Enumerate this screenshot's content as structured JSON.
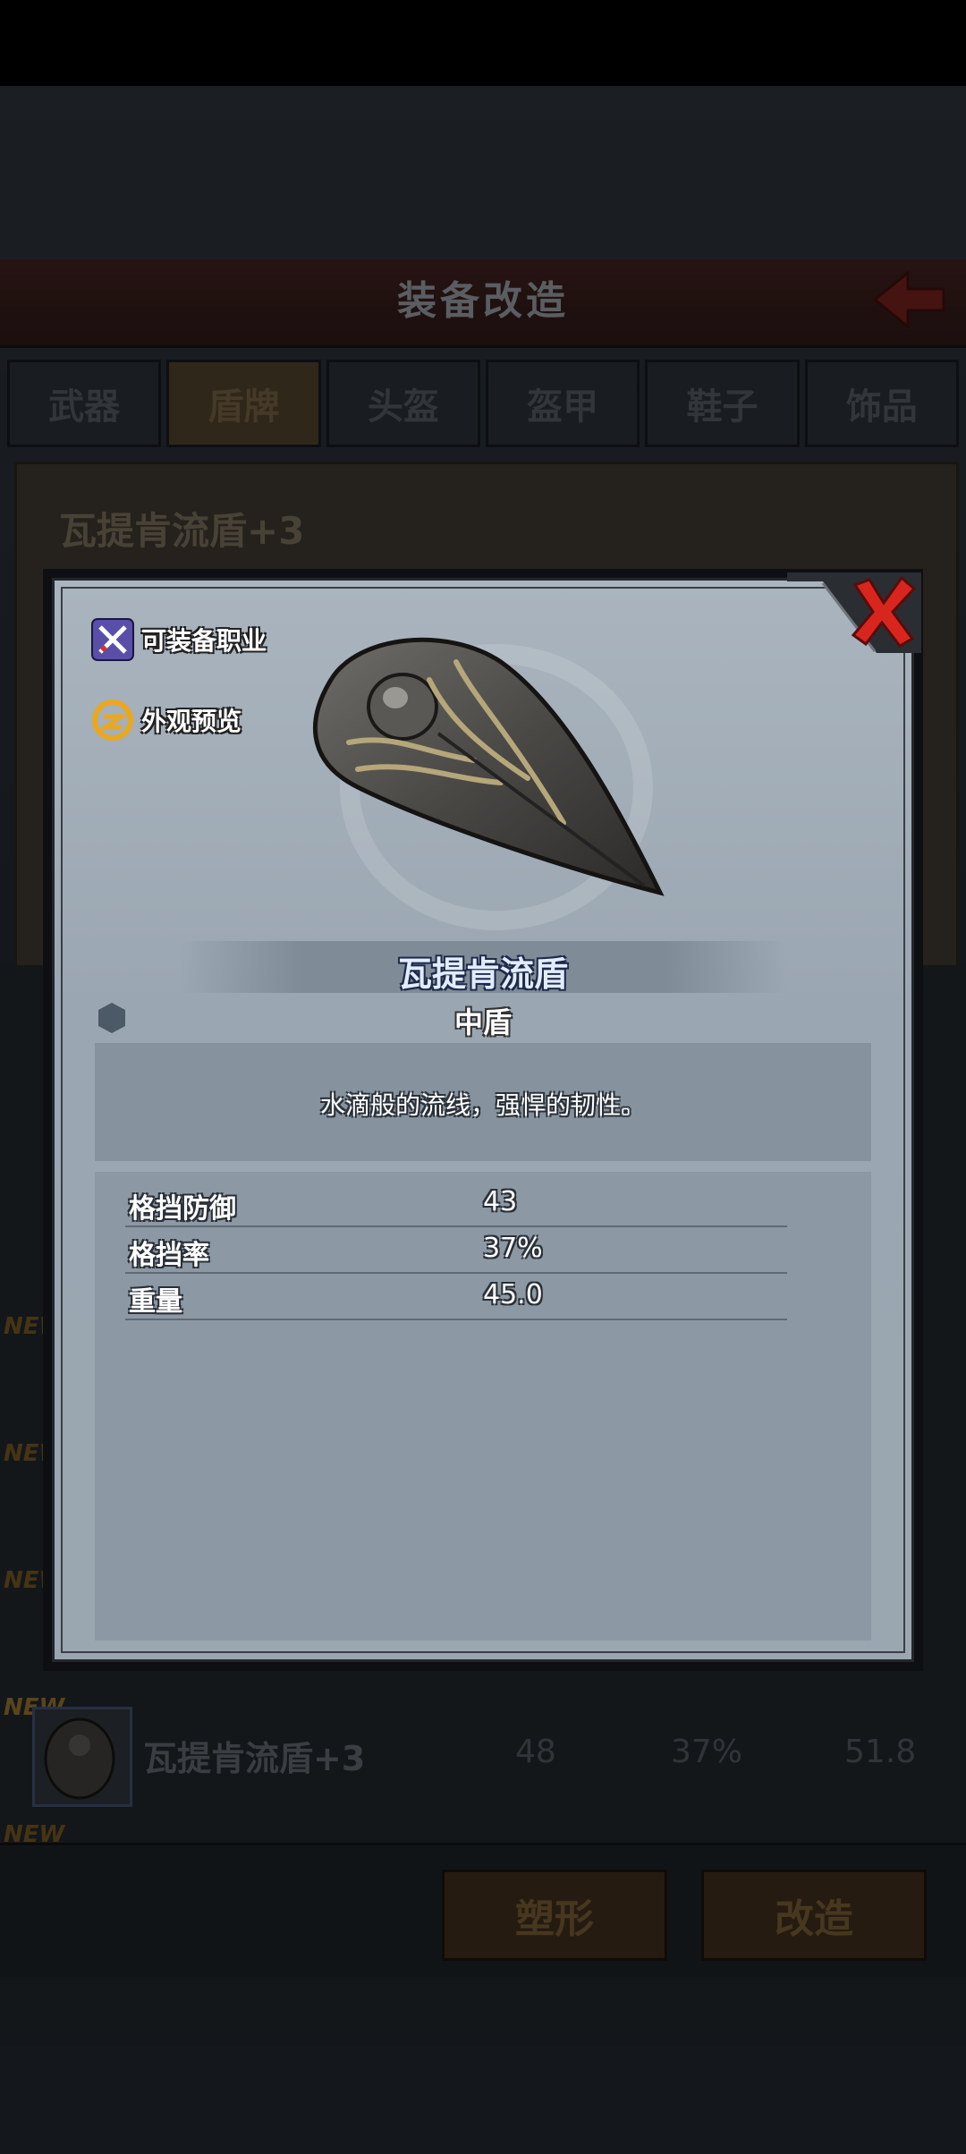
{
  "screen": {
    "title": "装备改造",
    "tabs": [
      "武器",
      "盾牌",
      "头盔",
      "盔甲",
      "鞋子",
      "饰品"
    ],
    "active_tab": "盾牌",
    "selected_item_name": "瓦提肯流盾+3",
    "new_badge": "NEW",
    "list_row": {
      "name": "瓦提肯流盾+3",
      "values": [
        "48",
        "37%",
        "51.8"
      ]
    },
    "buttons": {
      "reshape": "塑形",
      "modify": "改造"
    }
  },
  "modal": {
    "side_buttons": {
      "equip_class": "可装备职业",
      "appearance_preview": "外观预览"
    },
    "item": {
      "name": "瓦提肯流盾",
      "type": "中盾",
      "description": "水滴般的流线，强悍的韧性。"
    },
    "stats": [
      {
        "label": "格挡防御",
        "value": "43"
      },
      {
        "label": "格挡率",
        "value": "37%"
      },
      {
        "label": "重量",
        "value": "45.0"
      }
    ]
  },
  "colors": {
    "item_name": "#e2ecff",
    "close_red": "#d8261f",
    "modal_bg": "#9aa6b1"
  }
}
